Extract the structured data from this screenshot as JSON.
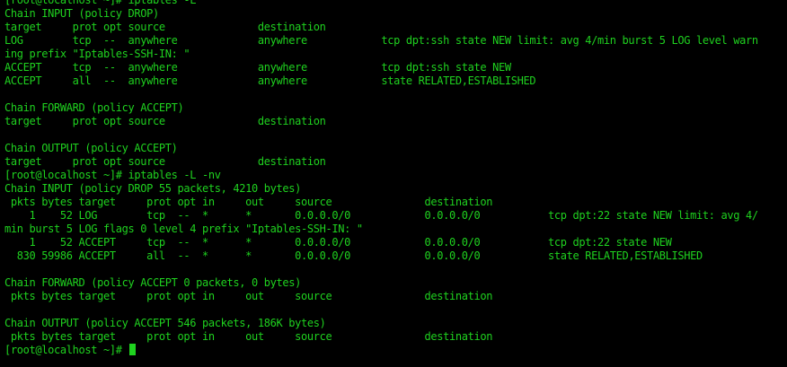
{
  "theme": {
    "background": "#000000",
    "text_color": "#1fd21f"
  },
  "terminal": {
    "lines": [
      "[root@localhost ~]# iptables -L",
      "Chain INPUT (policy DROP)",
      "target     prot opt source               destination",
      "LOG        tcp  --  anywhere             anywhere            tcp dpt:ssh state NEW limit: avg 4/min burst 5 LOG level warn",
      "ing prefix \"Iptables-SSH-IN: \"",
      "ACCEPT     tcp  --  anywhere             anywhere            tcp dpt:ssh state NEW",
      "ACCEPT     all  --  anywhere             anywhere            state RELATED,ESTABLISHED",
      "",
      "Chain FORWARD (policy ACCEPT)",
      "target     prot opt source               destination",
      "",
      "Chain OUTPUT (policy ACCEPT)",
      "target     prot opt source               destination",
      "[root@localhost ~]# iptables -L -nv",
      "Chain INPUT (policy DROP 55 packets, 4210 bytes)",
      " pkts bytes target     prot opt in     out     source               destination",
      "    1    52 LOG        tcp  --  *      *       0.0.0.0/0            0.0.0.0/0           tcp dpt:22 state NEW limit: avg 4/",
      "min burst 5 LOG flags 0 level 4 prefix \"Iptables-SSH-IN: \"",
      "    1    52 ACCEPT     tcp  --  *      *       0.0.0.0/0            0.0.0.0/0           tcp dpt:22 state NEW",
      "  830 59986 ACCEPT     all  --  *      *       0.0.0.0/0            0.0.0.0/0           state RELATED,ESTABLISHED",
      "",
      "Chain FORWARD (policy ACCEPT 0 packets, 0 bytes)",
      " pkts bytes target     prot opt in     out     source               destination",
      "",
      "Chain OUTPUT (policy ACCEPT 546 packets, 186K bytes)",
      " pkts bytes target     prot opt in     out     source               destination"
    ],
    "prompt": "[root@localhost ~]# "
  }
}
